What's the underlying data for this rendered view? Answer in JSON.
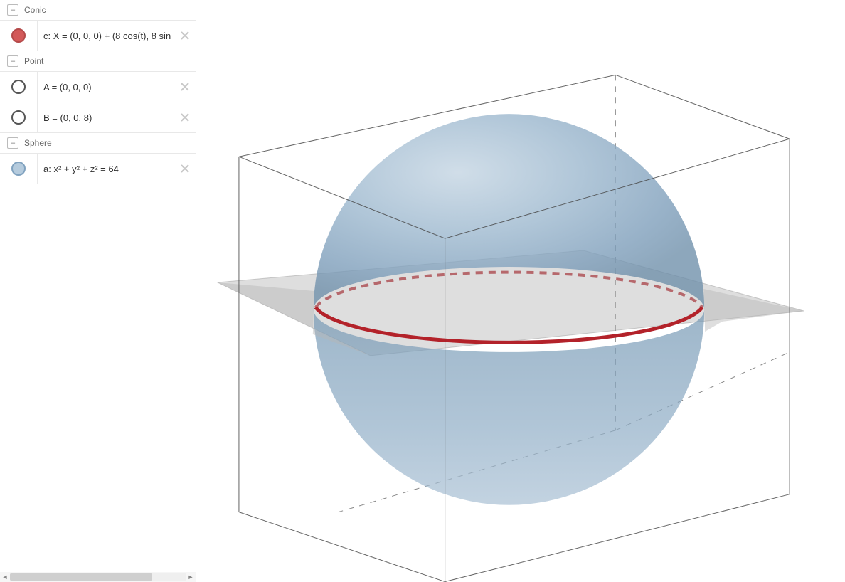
{
  "sidebar": {
    "categories": [
      {
        "name": "Conic",
        "items": [
          {
            "label": "c: X = (0, 0, 0) + (8 cos(t), 8 sin",
            "swatch": "red-filled"
          }
        ]
      },
      {
        "name": "Point",
        "items": [
          {
            "label": "A = (0, 0, 0)",
            "swatch": "empty"
          },
          {
            "label": "B = (0, 0, 8)",
            "swatch": "empty"
          }
        ]
      },
      {
        "name": "Sphere",
        "items": [
          {
            "label": "a: x² + y² + z² = 64",
            "swatch": "blue-filled"
          }
        ]
      }
    ]
  },
  "view3d": {
    "objects": {
      "sphere": {
        "equation": "x² + y² + z² = 64",
        "radius": 8,
        "center": [
          0,
          0,
          0
        ],
        "color": "#8aa9c3"
      },
      "conic": {
        "type": "circle",
        "center": [
          0,
          0,
          0
        ],
        "radius": 8,
        "color": "#b3222a"
      },
      "plane": {
        "z": 0,
        "color": "#b0b0b0"
      },
      "box": {
        "min": [
          -8,
          -8,
          -8
        ],
        "max": [
          8,
          8,
          8
        ]
      }
    }
  }
}
